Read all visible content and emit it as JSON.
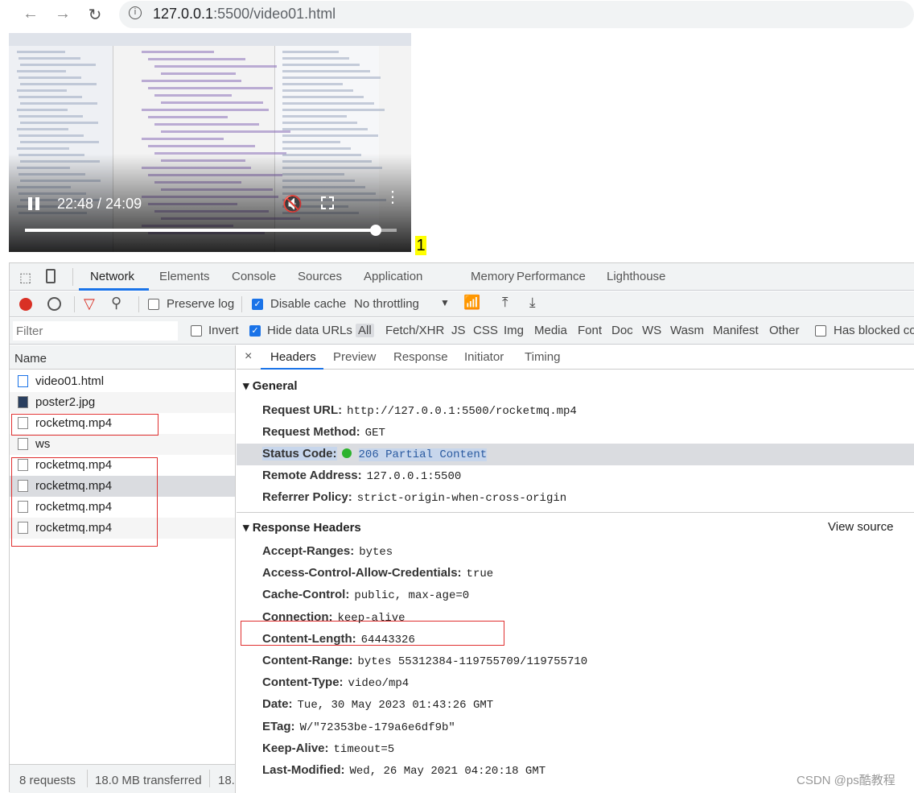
{
  "browser": {
    "url_host": "127.0.0.1",
    "url_rest": ":5500/video01.html"
  },
  "video": {
    "time": "22:48 / 24:09",
    "progress": 0.944
  },
  "badge": "1",
  "devtools": {
    "tabs": [
      "Network",
      "Elements",
      "Console",
      "Sources",
      "Application",
      "Memory",
      "Performance",
      "Lighthouse"
    ],
    "active_tab": "Network",
    "toolbar": {
      "preserve_log": "Preserve log",
      "disable_cache": "Disable cache",
      "throttling": "No throttling"
    },
    "filter": {
      "placeholder": "Filter",
      "invert": "Invert",
      "hide_data_urls": "Hide data URLs",
      "types": [
        "All",
        "Fetch/XHR",
        "JS",
        "CSS",
        "Img",
        "Media",
        "Font",
        "Doc",
        "WS",
        "Wasm",
        "Manifest",
        "Other"
      ],
      "has_blocked": "Has blocked co"
    },
    "list": {
      "header": "Name",
      "rows": [
        "video01.html",
        "poster2.jpg",
        "rocketmq.mp4",
        "ws",
        "rocketmq.mp4",
        "rocketmq.mp4",
        "rocketmq.mp4",
        "rocketmq.mp4"
      ]
    },
    "status": {
      "requests": "8 requests",
      "transferred": "18.0 MB transferred",
      "more": "18."
    },
    "detail_tabs": [
      "Headers",
      "Preview",
      "Response",
      "Initiator",
      "Timing"
    ],
    "general": {
      "title": "General",
      "rows": [
        {
          "k": "Request URL:",
          "v": "http://127.0.0.1:5500/rocketmq.mp4"
        },
        {
          "k": "Request Method:",
          "v": "GET"
        },
        {
          "k": "Status Code:",
          "v": "206 Partial Content"
        },
        {
          "k": "Remote Address:",
          "v": "127.0.0.1:5500"
        },
        {
          "k": "Referrer Policy:",
          "v": "strict-origin-when-cross-origin"
        }
      ]
    },
    "response": {
      "title": "Response Headers",
      "view_source": "View source",
      "rows": [
        {
          "k": "Accept-Ranges:",
          "v": "bytes"
        },
        {
          "k": "Access-Control-Allow-Credentials:",
          "v": "true"
        },
        {
          "k": "Cache-Control:",
          "v": "public, max-age=0"
        },
        {
          "k": "Connection:",
          "v": "keep-alive"
        },
        {
          "k": "Content-Length:",
          "v": "64443326"
        },
        {
          "k": "Content-Range:",
          "v": "bytes 55312384-119755709/119755710"
        },
        {
          "k": "Content-Type:",
          "v": "video/mp4"
        },
        {
          "k": "Date:",
          "v": "Tue, 30 May 2023 01:43:26 GMT"
        },
        {
          "k": "ETag:",
          "v": "W/\"72353be-179a6e6df9b\""
        },
        {
          "k": "Keep-Alive:",
          "v": "timeout=5"
        },
        {
          "k": "Last-Modified:",
          "v": "Wed, 26 May 2021 04:20:18 GMT"
        }
      ]
    }
  },
  "watermark": "CSDN @ps酷教程"
}
